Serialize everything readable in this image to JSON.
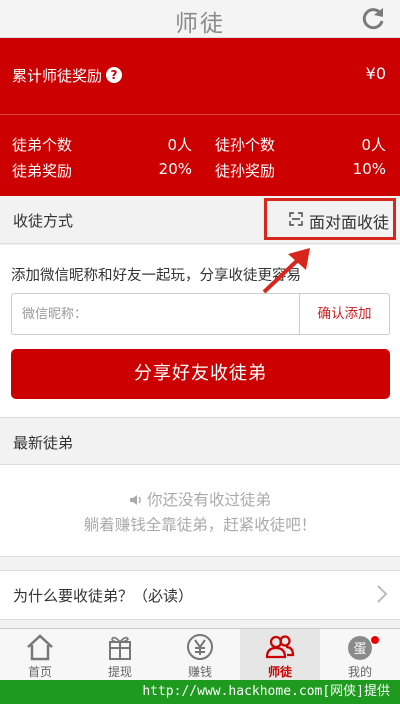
{
  "header": {
    "title": "师徒"
  },
  "stats": {
    "total_label": "累计师徒奖励",
    "help_symbol": "?",
    "total_value": "¥0",
    "apprentice_count_label": "徒弟个数",
    "apprentice_count_value": "0人",
    "grand_count_label": "徒孙个数",
    "grand_count_value": "0人",
    "apprentice_reward_label": "徒弟奖励",
    "apprentice_reward_value": "20%",
    "grand_reward_label": "徒孙奖励",
    "grand_reward_value": "10%"
  },
  "method": {
    "label": "收徒方式",
    "face_to_face": "面对面收徒"
  },
  "invite": {
    "description": "添加微信昵称和好友一起玩，分享收徒更容易",
    "input_placeholder": "微信昵称：",
    "input_value": "",
    "confirm_label": "确认添加",
    "share_label": "分享好友收徒弟"
  },
  "recent": {
    "label": "最新徒弟",
    "empty_line1": "你还没有收过徒弟",
    "empty_line2": "躺着赚钱全靠徒弟，赶紧收徒吧！"
  },
  "why": {
    "label": "为什么要收徒弟？（必读）"
  },
  "tabs": [
    {
      "label": "首页",
      "icon": "home-icon"
    },
    {
      "label": "提现",
      "icon": "gift-icon"
    },
    {
      "label": "赚钱",
      "icon": "yen-icon"
    },
    {
      "label": "师徒",
      "icon": "people-icon",
      "active": true
    },
    {
      "label": "我的",
      "icon": "egg-avatar-icon",
      "avatar_char": "蛋"
    }
  ],
  "watermark": "http://www.hackhome.com[网侠]提供",
  "colors": {
    "brand_red": "#cc0000",
    "highlight_box": "#d9261c",
    "watermark_green": "#1e9a1e"
  }
}
